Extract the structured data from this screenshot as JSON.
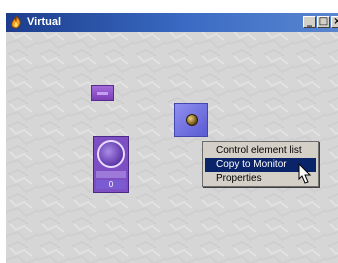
{
  "window": {
    "title": "Virtual"
  },
  "titlebar_buttons": {
    "minimize": "_",
    "maximize": "□",
    "close": "×"
  },
  "widgets": {
    "knob_value": "0"
  },
  "context_menu": {
    "items": [
      {
        "label": "Control element list"
      },
      {
        "label": "Copy to Monitor",
        "highlighted": true
      },
      {
        "label": "Properties"
      }
    ]
  },
  "colors": {
    "title_bar": "#1c3d8c",
    "menu_highlight": "#0a246a",
    "widget_purple": "#7d4fc2",
    "widget_blue": "#5a5ad2"
  },
  "icons": {
    "app": "fire-icon",
    "pointer": "hand-cursor-icon"
  }
}
